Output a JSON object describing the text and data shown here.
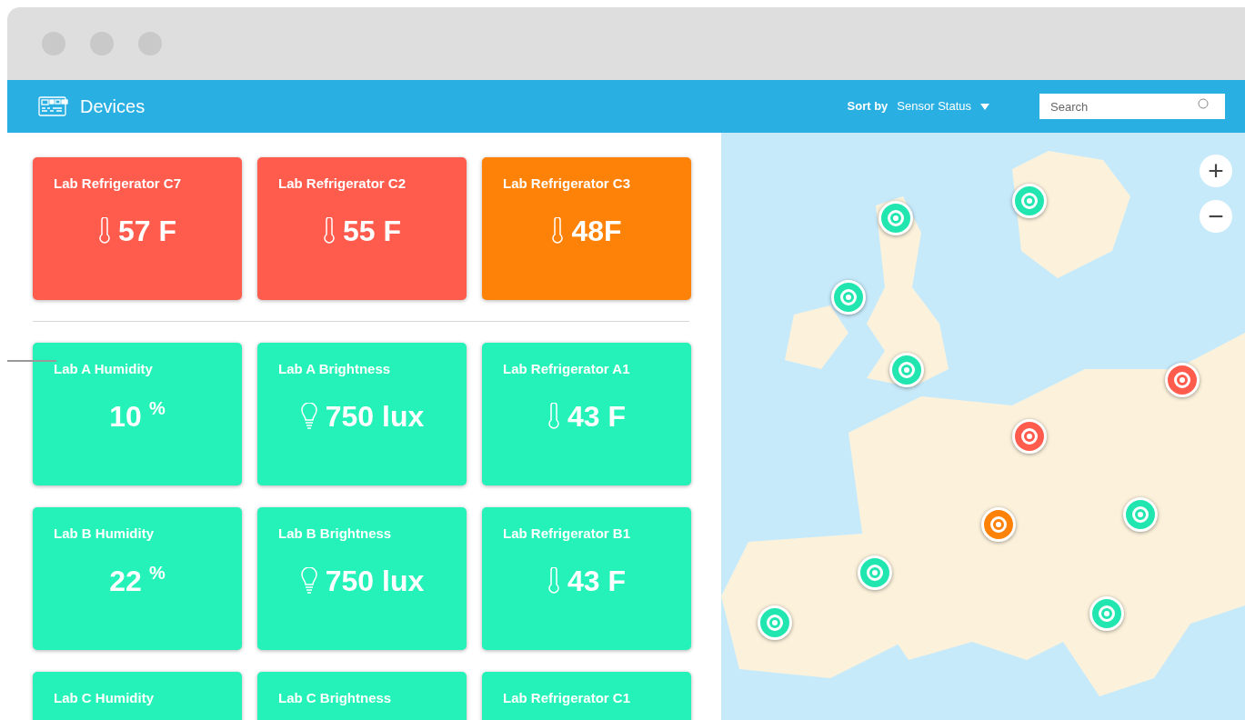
{
  "header": {
    "title": "Devices",
    "sort_label": "Sort by",
    "sort_value": "Sensor Status",
    "search": {
      "placeholder": "Search"
    }
  },
  "alert_cards": [
    {
      "name": "Lab Refrigerator C7",
      "kind": "temperature",
      "value": "57 F",
      "color": "#ff5c4d"
    },
    {
      "name": "Lab Refrigerator C2",
      "kind": "temperature",
      "value": "55 F",
      "color": "#ff5c4d"
    },
    {
      "name": "Lab Refrigerator C3",
      "kind": "temperature",
      "value": "48F",
      "color": "#ff8208"
    }
  ],
  "cards": [
    {
      "name": "Lab A Humidity",
      "kind": "humidity",
      "value": "10",
      "unit": "%",
      "color": "#25f2b8"
    },
    {
      "name": "Lab A Brightness",
      "kind": "brightness",
      "value": "750 lux",
      "color": "#25f2b8"
    },
    {
      "name": "Lab Refrigerator A1",
      "kind": "temperature",
      "value": "43 F",
      "color": "#25f2b8"
    },
    {
      "name": "Lab B Humidity",
      "kind": "humidity",
      "value": "22",
      "unit": "%",
      "color": "#25f2b8"
    },
    {
      "name": "Lab B Brightness",
      "kind": "brightness",
      "value": "750 lux",
      "color": "#25f2b8"
    },
    {
      "name": "Lab Refrigerator B1",
      "kind": "temperature",
      "value": "43 F",
      "color": "#25f2b8"
    },
    {
      "name": "Lab C Humidity",
      "kind": "humidity",
      "color": "#25f2b8"
    },
    {
      "name": "Lab C Brightness",
      "kind": "brightness",
      "color": "#25f2b8"
    },
    {
      "name": "Lab Refrigerator C1",
      "kind": "temperature",
      "color": "#25f2b8"
    }
  ],
  "map": {
    "zoom_in": "+",
    "zoom_out": "−",
    "pins": [
      {
        "color": "#22e6b0"
      },
      {
        "color": "#22e6b0"
      },
      {
        "color": "#22e6b0"
      },
      {
        "color": "#22e6b0"
      },
      {
        "color": "#ff5c4d"
      },
      {
        "color": "#ff5c4d"
      },
      {
        "color": "#ff8208"
      },
      {
        "color": "#22e6b0"
      },
      {
        "color": "#22e6b0"
      },
      {
        "color": "#22e6b0"
      },
      {
        "color": "#22e6b0"
      }
    ]
  }
}
